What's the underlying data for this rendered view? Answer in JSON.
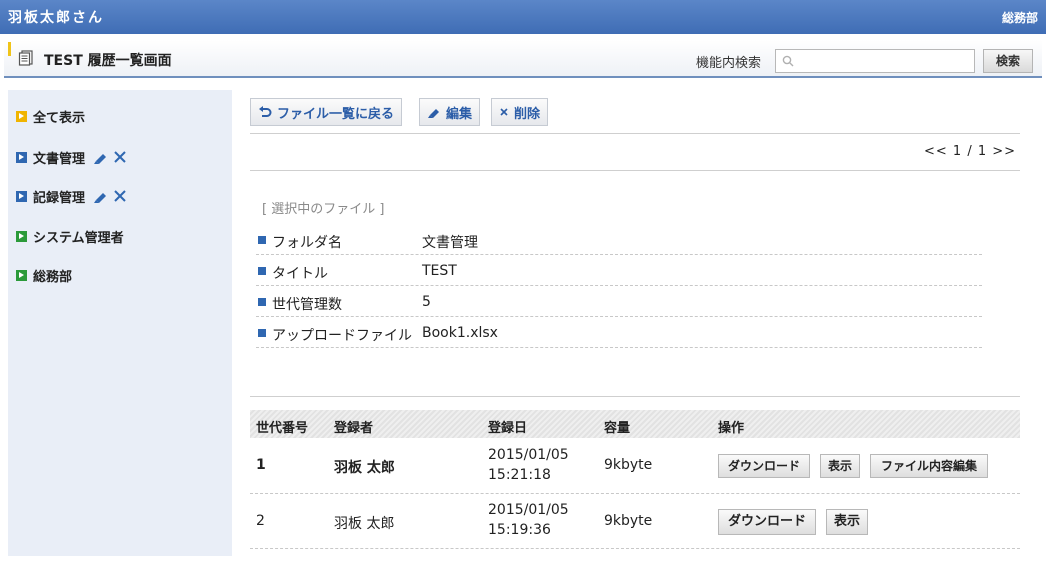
{
  "topbar": {
    "user": "羽板太郎さん",
    "department": "総務部"
  },
  "header": {
    "title": "TEST 履歴一覧画面",
    "search_label": "機能内検索",
    "search_placeholder": "",
    "search_button": "検索"
  },
  "sidebar": {
    "items": [
      {
        "label": "全て表示",
        "color": "#f0b400"
      },
      {
        "label": "文書管理",
        "color": "#2f67b1"
      },
      {
        "label": "記録管理",
        "color": "#2f67b1"
      },
      {
        "label": "システム管理者",
        "color": "#2b9a3a"
      },
      {
        "label": "総務部",
        "color": "#2b9a3a"
      }
    ]
  },
  "toolbar": {
    "back_label": "ファイル一覧に戻る",
    "edit_label": "編集",
    "delete_label": "削除"
  },
  "pager": {
    "text": "<< 1 / 1 >>"
  },
  "selected_file": {
    "section_title": "[ 選択中のファイル ]",
    "fields": [
      {
        "key": "フォルダ名",
        "value": "文書管理"
      },
      {
        "key": "タイトル",
        "value": "TEST"
      },
      {
        "key": "世代管理数",
        "value": "5"
      },
      {
        "key": "アップロードファイル",
        "value": "Book1.xlsx"
      }
    ]
  },
  "history": {
    "columns": [
      "世代番号",
      "登録者",
      "登録日",
      "容量",
      "操作"
    ],
    "rows": [
      {
        "gen": "1",
        "user": "羽板 太郎",
        "date": "2015/01/05",
        "time": "15:21:18",
        "size": "9kbyte",
        "download": "ダウンロード",
        "view": "表示",
        "edit_content": "ファイル内容編集"
      },
      {
        "gen": "2",
        "user": "羽板 太郎",
        "date": "2015/01/05",
        "time": "15:19:36",
        "size": "9kbyte",
        "download": "ダウンロード",
        "view": "表示"
      }
    ]
  },
  "colors": {
    "brand": "#3f6db5",
    "accent_blue": "#2b5da8",
    "marker_yellow": "#f0c419"
  }
}
